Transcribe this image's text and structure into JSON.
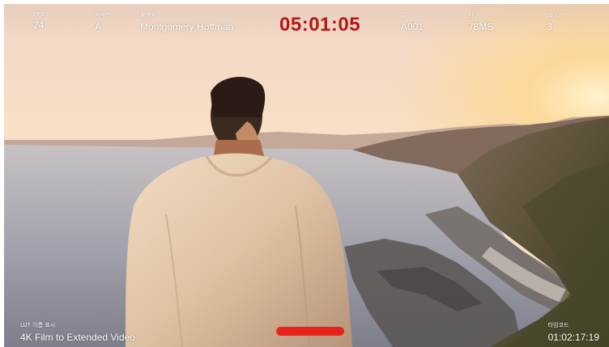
{
  "header": {
    "fps": {
      "label": "FPS",
      "value": "24"
    },
    "camera": {
      "label": "카메라",
      "value": "A"
    },
    "operator": {
      "label": "촬영자",
      "value": "Montgomery Hoffman"
    },
    "timecode": "05:01:05",
    "reel": {
      "label": "릴",
      "value": "A001"
    },
    "scene": {
      "label": "신",
      "value": "78MS"
    },
    "take": {
      "label": "테이크",
      "value": "3"
    }
  },
  "footer": {
    "lut": {
      "label": "LUT 이름 표시",
      "value": "4K Film to Extended Video"
    },
    "tc": {
      "label": "타임코드",
      "value": "01:02:17:19"
    }
  },
  "recording": {
    "active": true,
    "color": "#e8211c"
  },
  "colors": {
    "timecode": "#b51818",
    "text": "#ffffff"
  }
}
